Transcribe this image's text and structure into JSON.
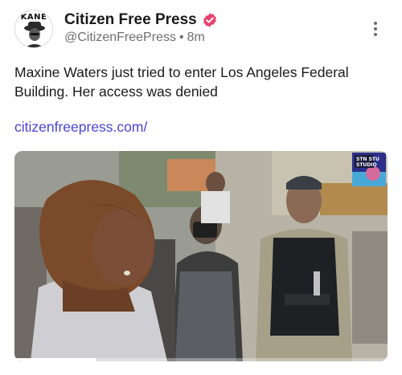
{
  "account": {
    "name": "Citizen Free Press",
    "handle": "@CitizenFreePress",
    "separator": "•",
    "time": "8m",
    "avatar_text": "KANE",
    "verified_icon": "verified-badge-icon",
    "verified_color": "#e8426b"
  },
  "post": {
    "text": "Maxine Waters just tried to enter Los Angeles Federal Building. Her access was denied",
    "link": "citizenfreepress.com/",
    "link_color": "#4b43d9"
  },
  "media": {
    "type": "video",
    "watermark_text": "STN STU STUDIO",
    "progress": 0.22
  },
  "menu": {
    "icon": "more-vertical-icon"
  }
}
